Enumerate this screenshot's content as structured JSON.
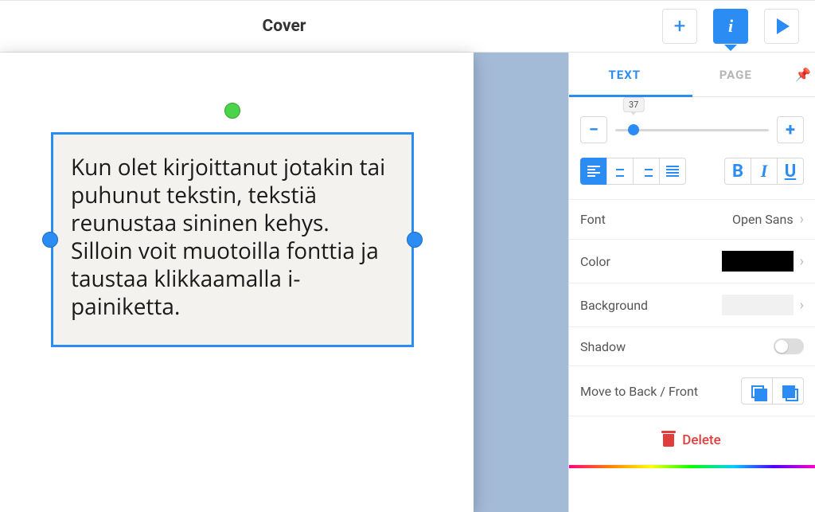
{
  "header": {
    "title": "Cover"
  },
  "canvas": {
    "textbox": "Kun olet kirjoittanut jotakin tai puhunut tekstin, tekstiä reunustaa sininen kehys. Silloin voit muotoilla fonttia ja taustaa klikkaamalla i-painiketta."
  },
  "sidebar": {
    "tabs": {
      "text": "TEXT",
      "page": "PAGE"
    },
    "size": {
      "value": "37"
    },
    "font": {
      "label": "Font",
      "value": "Open Sans"
    },
    "color": {
      "label": "Color"
    },
    "background": {
      "label": "Background"
    },
    "shadow": {
      "label": "Shadow"
    },
    "move": {
      "label": "Move to Back / Front"
    },
    "delete": {
      "label": "Delete"
    }
  }
}
